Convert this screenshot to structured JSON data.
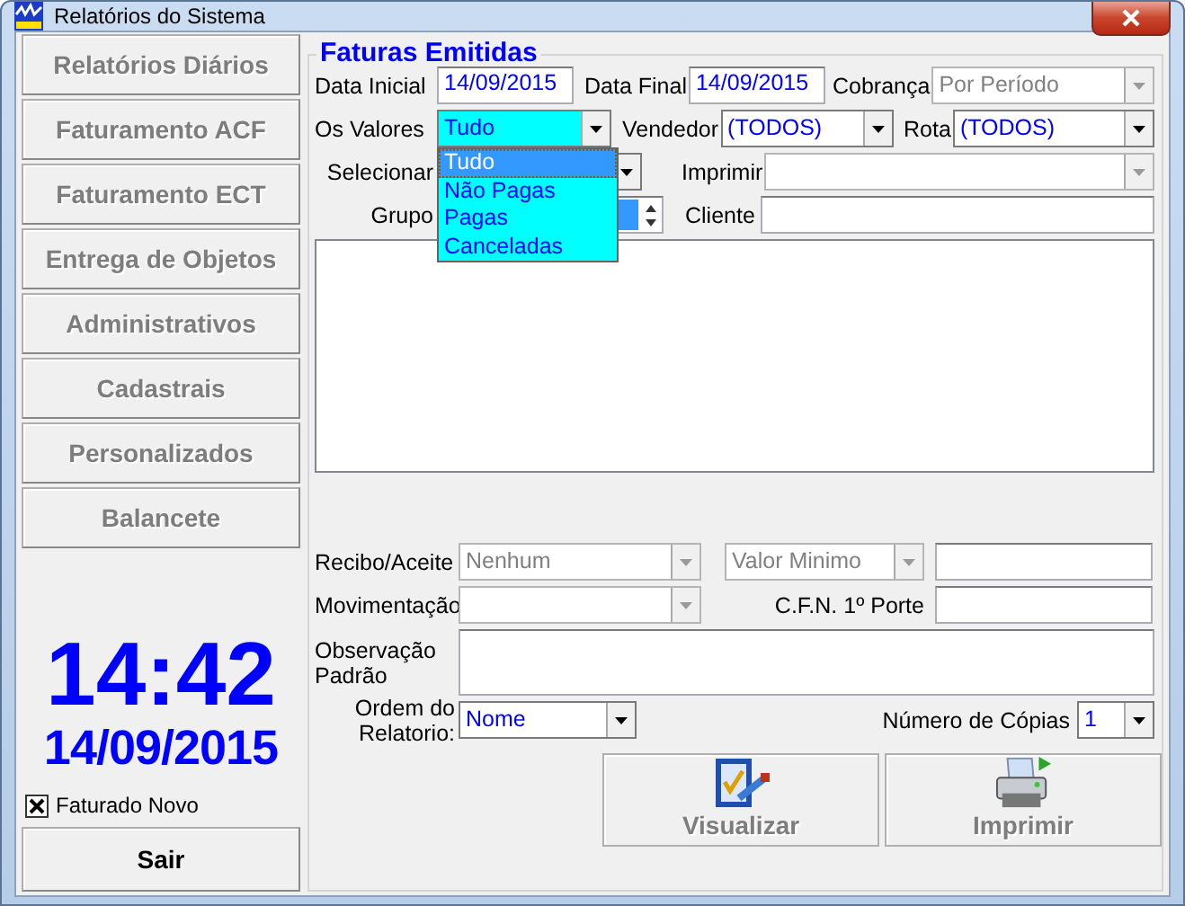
{
  "window": {
    "title": "Relatórios do Sistema"
  },
  "sidebar": {
    "items": [
      {
        "label": "Relatórios Diários",
        "disabled": true
      },
      {
        "label": "Faturamento ACF",
        "disabled": true
      },
      {
        "label": "Faturamento ECT",
        "disabled": true
      },
      {
        "label": "Entrega de Objetos",
        "disabled": true
      },
      {
        "label": "Administrativos",
        "disabled": true
      },
      {
        "label": "Cadastrais",
        "disabled": true
      },
      {
        "label": "Personalizados",
        "disabled": true
      },
      {
        "label": "Balancete",
        "disabled": true
      }
    ]
  },
  "clock": {
    "time": "14:42",
    "date": "14/09/2015"
  },
  "faturado_novo": {
    "label": "Faturado Novo",
    "checked": true
  },
  "exit_button": {
    "label": "Sair",
    "disabled": false
  },
  "group": {
    "title": "Faturas Emitidas"
  },
  "data_inicial": {
    "label": "Data Inicial",
    "value": "14/09/2015"
  },
  "data_final": {
    "label": "Data Final",
    "value": "14/09/2015"
  },
  "cobranca": {
    "label": "Cobrança",
    "value": "Por Período",
    "disabled": true
  },
  "os_valores": {
    "label": "Os Valores",
    "value": "Tudo",
    "expanded": true,
    "options": [
      {
        "label": "Tudo",
        "selected": true
      },
      {
        "label": "Não Pagas",
        "selected": false
      },
      {
        "label": "Pagas",
        "selected": false
      },
      {
        "label": "Canceladas",
        "selected": false
      }
    ]
  },
  "vendedor": {
    "label": "Vendedor",
    "value": "(TODOS)",
    "disabled": false
  },
  "rota": {
    "label": "Rota",
    "value": "(TODOS)",
    "disabled": false
  },
  "selecionar": {
    "label": "Selecionar",
    "disabled": false
  },
  "imprimir": {
    "label": "Imprimir",
    "disabled": true
  },
  "grupo": {
    "label": "Grupo"
  },
  "cliente": {
    "label": "Cliente"
  },
  "recibo": {
    "label": "Recibo/Aceite",
    "value": "Nenhum",
    "disabled": true
  },
  "valor_minimo": {
    "value": "Valor Minimo",
    "disabled": true
  },
  "movimentacao": {
    "label": "Movimentação",
    "disabled": true
  },
  "cfn": {
    "label": "C.F.N. 1º Porte"
  },
  "observacao": {
    "label": "Observação Padrão"
  },
  "ordem": {
    "label": "Ordem do Relatorio:",
    "value": "Nome",
    "disabled": false
  },
  "copias": {
    "label": "Número de Cópias",
    "value": "1",
    "disabled": false
  },
  "actions": [
    {
      "label": "Visualizar",
      "kind": "preview",
      "disabled": true
    },
    {
      "label": "Imprimir",
      "kind": "print",
      "disabled": true
    }
  ]
}
